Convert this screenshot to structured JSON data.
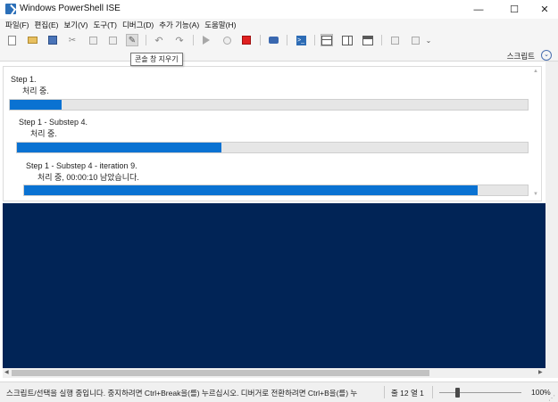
{
  "window": {
    "title": "Windows PowerShell ISE",
    "controls": {
      "minimize": "—",
      "maximize": "☐",
      "close": "✕"
    }
  },
  "menu": [
    "파일(F)",
    "편집(E)",
    "보기(V)",
    "도구(T)",
    "디버그(D)",
    "추가 기능(A)",
    "도움말(H)"
  ],
  "toolbar": {
    "overflow": "⌄"
  },
  "tooltip": {
    "text": "콘솔 창 지우기"
  },
  "script_bar": {
    "label": "스크립트",
    "toggle_icon": "⌄"
  },
  "progress": [
    {
      "label": "Step 1.",
      "status": "처리 중.",
      "percent": 10
    },
    {
      "label": "Step 1 - Substep 4.",
      "status": "처리 중.",
      "percent": 40
    },
    {
      "label": "Step 1 - Substep 4 - iteration 9.",
      "status": "처리 중, 00:00:10 남았습니다.",
      "percent": 90
    }
  ],
  "status": {
    "message": "스크립트/선택을 실행 중입니다. 중지하려면 Ctrl+Break을(를) 누르십시오. 디버거로 전환하려면 Ctrl+B을(를) 누",
    "position": "줄 12  열 1",
    "zoom": "100%",
    "zoom_percent": 100
  },
  "colors": {
    "console_bg": "#012456",
    "progress_fill": "#0a72d2",
    "stop_red": "#e02020"
  }
}
